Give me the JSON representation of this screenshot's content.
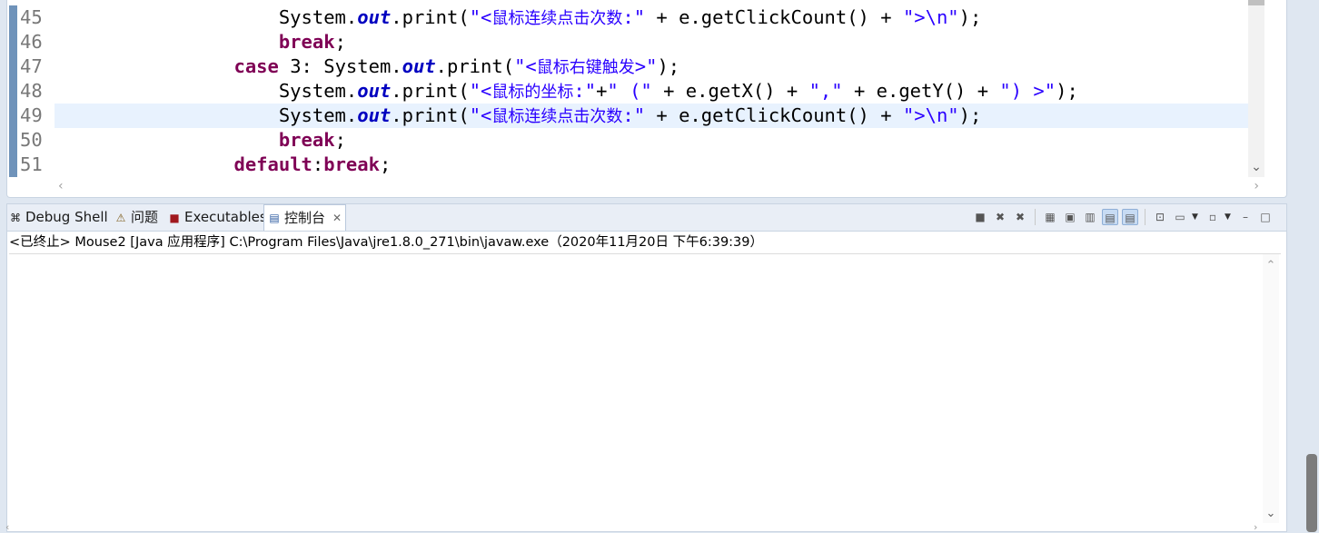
{
  "editor": {
    "lines": [
      {
        "num": "45",
        "segments": [
          {
            "t": "                    System.",
            "c": ""
          },
          {
            "t": "out",
            "c": "fld"
          },
          {
            "t": ".print(",
            "c": ""
          },
          {
            "t": "\"<",
            "c": "str"
          },
          {
            "t": "鼠标连续点击次数",
            "c": "str cjk"
          },
          {
            "t": ":\"",
            "c": "str"
          },
          {
            "t": " + e.getClickCount() + ",
            "c": ""
          },
          {
            "t": "\">\\n\"",
            "c": "str"
          },
          {
            "t": ");",
            "c": ""
          }
        ]
      },
      {
        "num": "46",
        "segments": [
          {
            "t": "                    ",
            "c": ""
          },
          {
            "t": "break",
            "c": "kw"
          },
          {
            "t": ";",
            "c": ""
          }
        ]
      },
      {
        "num": "47",
        "segments": [
          {
            "t": "                ",
            "c": ""
          },
          {
            "t": "case",
            "c": "kw"
          },
          {
            "t": " 3: System.",
            "c": ""
          },
          {
            "t": "out",
            "c": "fld"
          },
          {
            "t": ".print(",
            "c": ""
          },
          {
            "t": "\"<",
            "c": "str"
          },
          {
            "t": "鼠标右键触发",
            "c": "str cjk"
          },
          {
            "t": ">\"",
            "c": "str"
          },
          {
            "t": ");",
            "c": ""
          }
        ]
      },
      {
        "num": "48",
        "segments": [
          {
            "t": "                    System.",
            "c": ""
          },
          {
            "t": "out",
            "c": "fld"
          },
          {
            "t": ".print(",
            "c": ""
          },
          {
            "t": "\"<",
            "c": "str"
          },
          {
            "t": "鼠标的坐标",
            "c": "str cjk"
          },
          {
            "t": ":\"",
            "c": "str"
          },
          {
            "t": "+",
            "c": ""
          },
          {
            "t": "\" (\"",
            "c": "str"
          },
          {
            "t": " + e.getX() + ",
            "c": ""
          },
          {
            "t": "\",\"",
            "c": "str"
          },
          {
            "t": " + e.getY() + ",
            "c": ""
          },
          {
            "t": "\") >\"",
            "c": "str"
          },
          {
            "t": ");",
            "c": ""
          }
        ]
      },
      {
        "num": "49",
        "current": true,
        "segments": [
          {
            "t": "                    System.",
            "c": ""
          },
          {
            "t": "out",
            "c": "fld"
          },
          {
            "t": ".print(",
            "c": ""
          },
          {
            "t": "\"<",
            "c": "str"
          },
          {
            "t": "鼠标连续点击次数",
            "c": "str cjk"
          },
          {
            "t": ":\"",
            "c": "str"
          },
          {
            "t": " + e.getClickCount() + ",
            "c": ""
          },
          {
            "t": "\">\\n\"",
            "c": "str"
          },
          {
            "t": ");",
            "c": ""
          }
        ]
      },
      {
        "num": "50",
        "segments": [
          {
            "t": "                    ",
            "c": ""
          },
          {
            "t": "break",
            "c": "kw"
          },
          {
            "t": ";",
            "c": ""
          }
        ]
      },
      {
        "num": "51",
        "segments": [
          {
            "t": "                ",
            "c": ""
          },
          {
            "t": "default",
            "c": "kw"
          },
          {
            "t": ":",
            "c": ""
          },
          {
            "t": "break",
            "c": "kw"
          },
          {
            "t": ";",
            "c": ""
          }
        ]
      }
    ]
  },
  "tabs": [
    {
      "label": "Debug Shell",
      "icon": "debug-shell-icon",
      "glyph": "⌘"
    },
    {
      "label": "问题",
      "icon": "problems-icon",
      "glyph": "⚠"
    },
    {
      "label": "Executables",
      "icon": "executables-icon",
      "glyph": "■"
    },
    {
      "label": "控制台",
      "icon": "console-icon",
      "glyph": "▤",
      "active": true
    }
  ],
  "console": {
    "status": "<已终止> Mouse2 [Java 应用程序] C:\\Program Files\\Java\\jre1.8.0_271\\bin\\javaw.exe（2020年11月20日 下午6:39:39）",
    "output": ""
  },
  "toolbar": [
    {
      "name": "terminate-button",
      "glyph": "■"
    },
    {
      "name": "remove-launch-button",
      "glyph": "✖"
    },
    {
      "name": "remove-all-terminated-button",
      "glyph": "✖"
    },
    {
      "sep": true
    },
    {
      "name": "clear-console-button",
      "glyph": "▦"
    },
    {
      "name": "scroll-lock-button",
      "glyph": "▣"
    },
    {
      "name": "word-wrap-button",
      "glyph": "▥"
    },
    {
      "name": "show-stdout-button",
      "glyph": "▤",
      "on": true
    },
    {
      "name": "show-stderr-button",
      "glyph": "▤",
      "on": true
    },
    {
      "sep": true
    },
    {
      "name": "pin-console-button",
      "glyph": "⊡"
    },
    {
      "name": "display-console-button",
      "glyph": "▭"
    },
    {
      "drop": true
    },
    {
      "name": "open-console-button",
      "glyph": "▫"
    },
    {
      "drop": true
    },
    {
      "name": "minimize-button",
      "glyph": "–"
    },
    {
      "name": "maximize-button",
      "glyph": "□"
    }
  ]
}
